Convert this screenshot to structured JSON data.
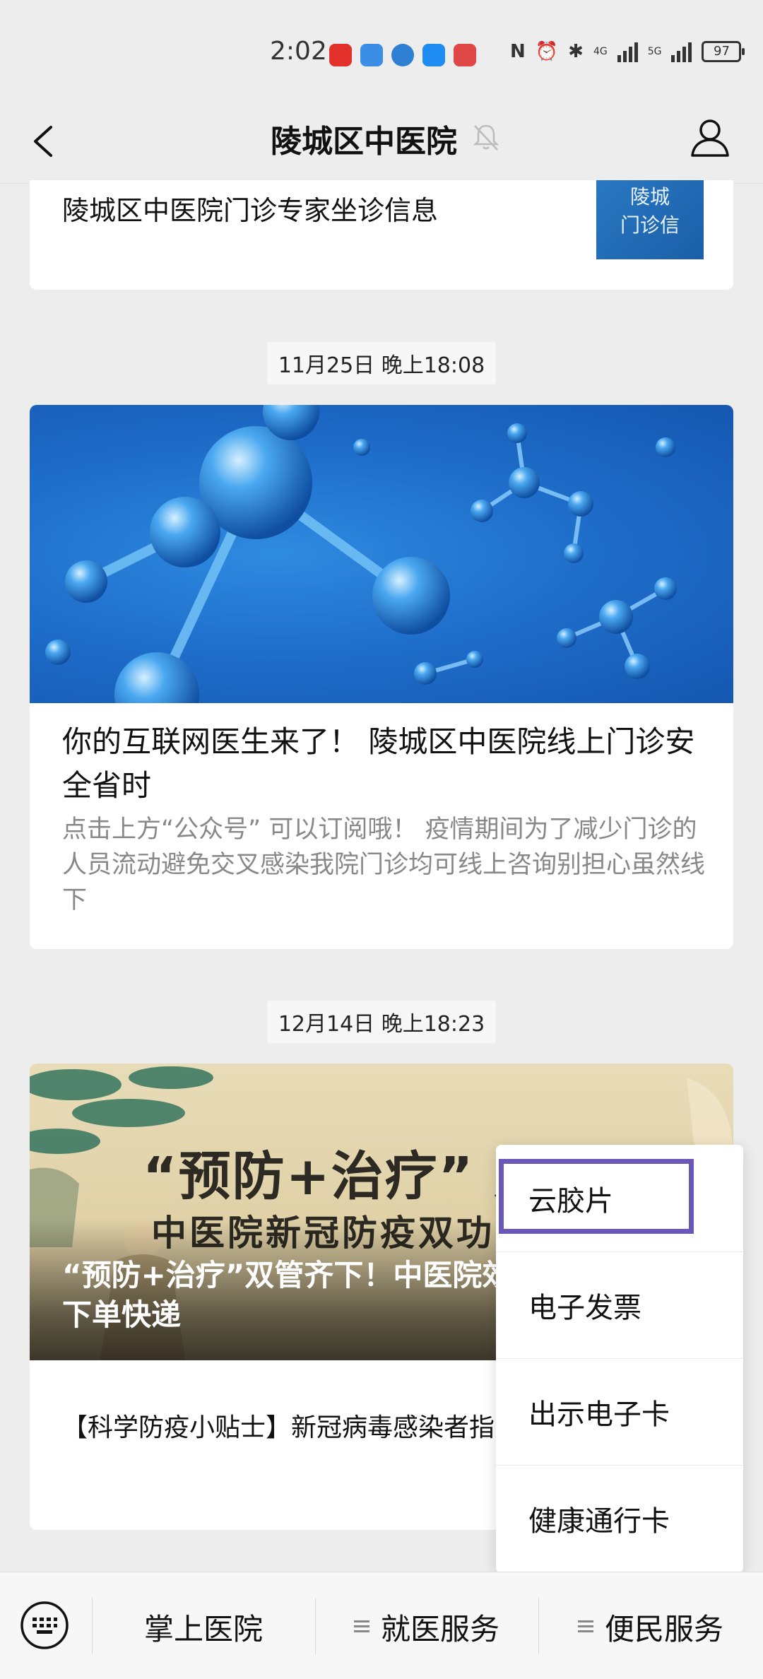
{
  "status_bar": {
    "time": "2:02",
    "network_4g": "4G",
    "network_5g": "5G",
    "battery": "97"
  },
  "nav": {
    "title": "陵城区中医院"
  },
  "articles": {
    "first": {
      "title": "陵城区中医院门诊专家坐诊信息",
      "thumb_text": "陵城\n门诊信"
    },
    "time_1": "11月25日 晚上18:08",
    "second": {
      "title": "你的互联网医生来了！ 陵城区中医院线上门诊安全省时",
      "desc": "点击上方“公众号” 可以订阅哦！ 疫情期间为了减少门诊的人员流动避免交叉感染我院门诊均可线上咨询别担心虽然线下"
    },
    "time_2": "12月14日 晚上18:23",
    "third": {
      "image_slogan": "“预防+治疗” 双",
      "image_subslogan": "中医院新冠防疫双功",
      "overlay_title": "“预防+治疗”双管齐下！中医院效中药方可手机下单快递",
      "sub_article": "【科学防疫小贴士】新冠病毒感染者指引（第一版）"
    }
  },
  "popup_menu": {
    "items": [
      "云胶片",
      "电子发票",
      "出示电子卡",
      "健康通行卡"
    ]
  },
  "bottom_bar": {
    "tab_1": "掌上医院",
    "tab_2": "就医服务",
    "tab_3": "便民服务"
  }
}
